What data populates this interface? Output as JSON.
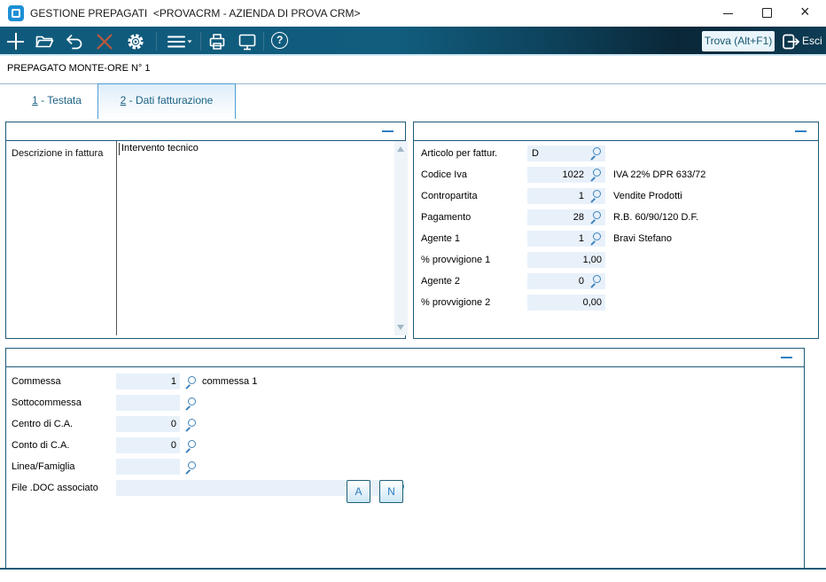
{
  "window": {
    "title": "GESTIONE PREPAGATI  <PROVACRM - AZIENDA DI PROVA CRM>"
  },
  "toolbar": {
    "find_label": "Trova (Alt+F1)",
    "exit_label": "Esci"
  },
  "record_header": "PREPAGATO MONTE-ORE N° 1",
  "tabs": {
    "testata": {
      "num": "1",
      "rest": " - Testata"
    },
    "dati": {
      "num": "2",
      "rest": " - Dati fatturazione"
    }
  },
  "left_panel": {
    "label": "Descrizione in fattura",
    "text": "Intervento tecnico"
  },
  "right_panel": {
    "rows": [
      {
        "label": "Articolo per fattur.",
        "value": "D",
        "desc": ""
      },
      {
        "label": "Codice Iva",
        "value": "1022",
        "desc": "IVA 22% DPR 633/72"
      },
      {
        "label": "Contropartita",
        "value": "1",
        "desc": "Vendite Prodotti"
      },
      {
        "label": "Pagamento",
        "value": "28",
        "desc": "R.B. 60/90/120 D.F."
      },
      {
        "label": "Agente 1",
        "value": "1",
        "desc": "Bravi Stefano"
      },
      {
        "label": "% provvigione 1",
        "value": "1,00",
        "desc": ""
      },
      {
        "label": "Agente 2",
        "value": "0",
        "desc": ""
      },
      {
        "label": "% provvigione 2",
        "value": "0,00",
        "desc": ""
      }
    ]
  },
  "bottom_panel": {
    "rows": [
      {
        "label": "Commessa",
        "value": "1",
        "desc": "commessa 1"
      },
      {
        "label": "Sottocommessa",
        "value": "",
        "desc": ""
      },
      {
        "label": "Centro di C.A.",
        "value": "0",
        "desc": ""
      },
      {
        "label": "Conto di C.A.",
        "value": "0",
        "desc": ""
      },
      {
        "label": "Linea/Famiglia",
        "value": "",
        "desc": ""
      },
      {
        "label": "File .DOC associato",
        "value": "",
        "desc": ""
      }
    ],
    "buttons": {
      "a": "A",
      "n": "N"
    }
  },
  "colors": {
    "toolbar_teal": "#0f5a7c",
    "toolbar_dark": "#0a2737",
    "panel_border": "#1d5a78",
    "field_bg": "#e8f1fa",
    "tab_border": "#4f9dd5",
    "accent_blue": "#2f80c3",
    "lookup_blue": "#3e83bc",
    "delete_red": "#c0583a"
  }
}
